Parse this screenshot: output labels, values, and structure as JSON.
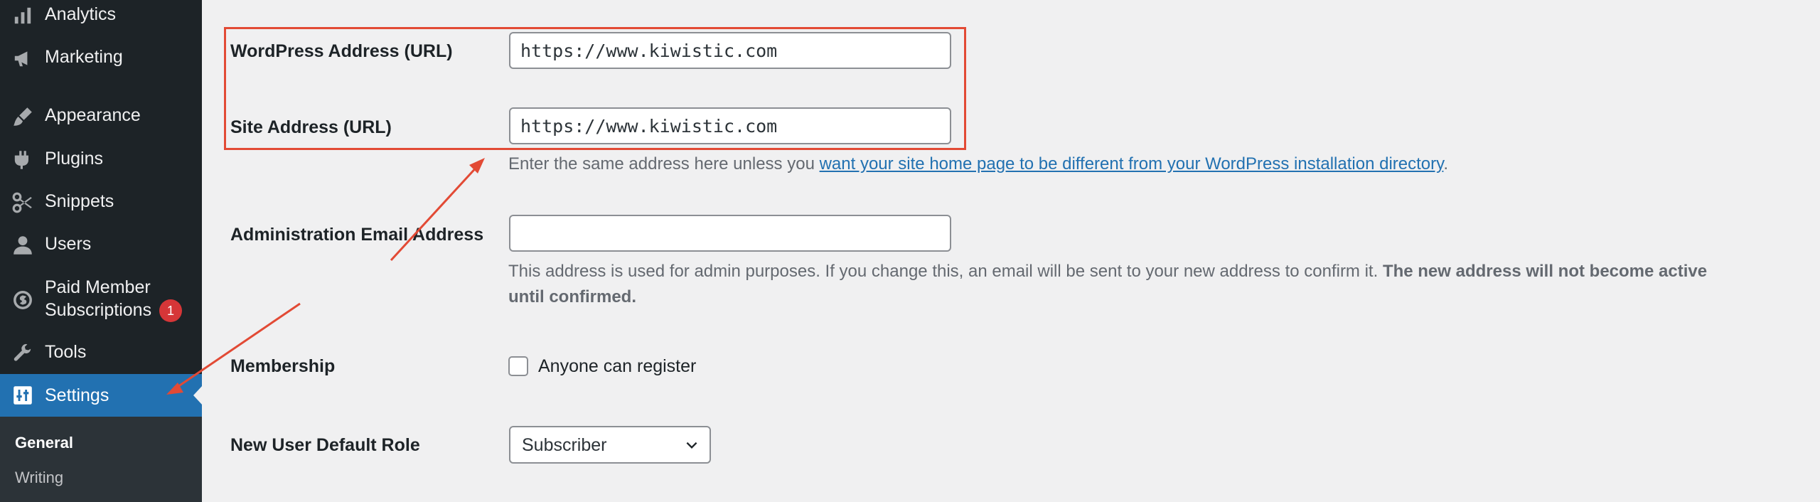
{
  "sidebar": {
    "items": [
      {
        "label": "Analytics",
        "icon": "bar-chart-icon"
      },
      {
        "label": "Marketing",
        "icon": "megaphone-icon"
      },
      {
        "label": "Appearance",
        "icon": "paintbrush-icon"
      },
      {
        "label": "Plugins",
        "icon": "plugin-icon"
      },
      {
        "label": "Snippets",
        "icon": "scissors-icon"
      },
      {
        "label": "Users",
        "icon": "user-icon"
      },
      {
        "label": "Paid Member Subscriptions",
        "icon": "subscription-icon",
        "badge": "1"
      },
      {
        "label": "Tools",
        "icon": "wrench-icon"
      },
      {
        "label": "Settings",
        "icon": "settings-icon",
        "active": true
      }
    ],
    "submenu": [
      {
        "label": "General",
        "current": true
      },
      {
        "label": "Writing"
      }
    ]
  },
  "form": {
    "wordpress_address": {
      "label": "WordPress Address (URL)",
      "value": "https://www.kiwistic.com"
    },
    "site_address": {
      "label": "Site Address (URL)",
      "value": "https://www.kiwistic.com",
      "description_prefix": "Enter the same address here unless you ",
      "description_link": "want your site home page to be different from your WordPress installation directory",
      "description_suffix": "."
    },
    "admin_email": {
      "label": "Administration Email Address",
      "value": "",
      "description": "This address is used for admin purposes. If you change this, an email will be sent to your new address to confirm it. ",
      "description_bold": "The new address will not become active until confirmed."
    },
    "membership": {
      "label": "Membership",
      "checkbox_label": "Anyone can register",
      "checked": false
    },
    "default_role": {
      "label": "New User Default Role",
      "selected": "Subscriber"
    }
  },
  "colors": {
    "sidebar_bg": "#1d2327",
    "active_menu_bg": "#2271b1",
    "annotation_red": "#e24a35",
    "badge_red": "#d63638",
    "link_blue": "#2271b1"
  }
}
